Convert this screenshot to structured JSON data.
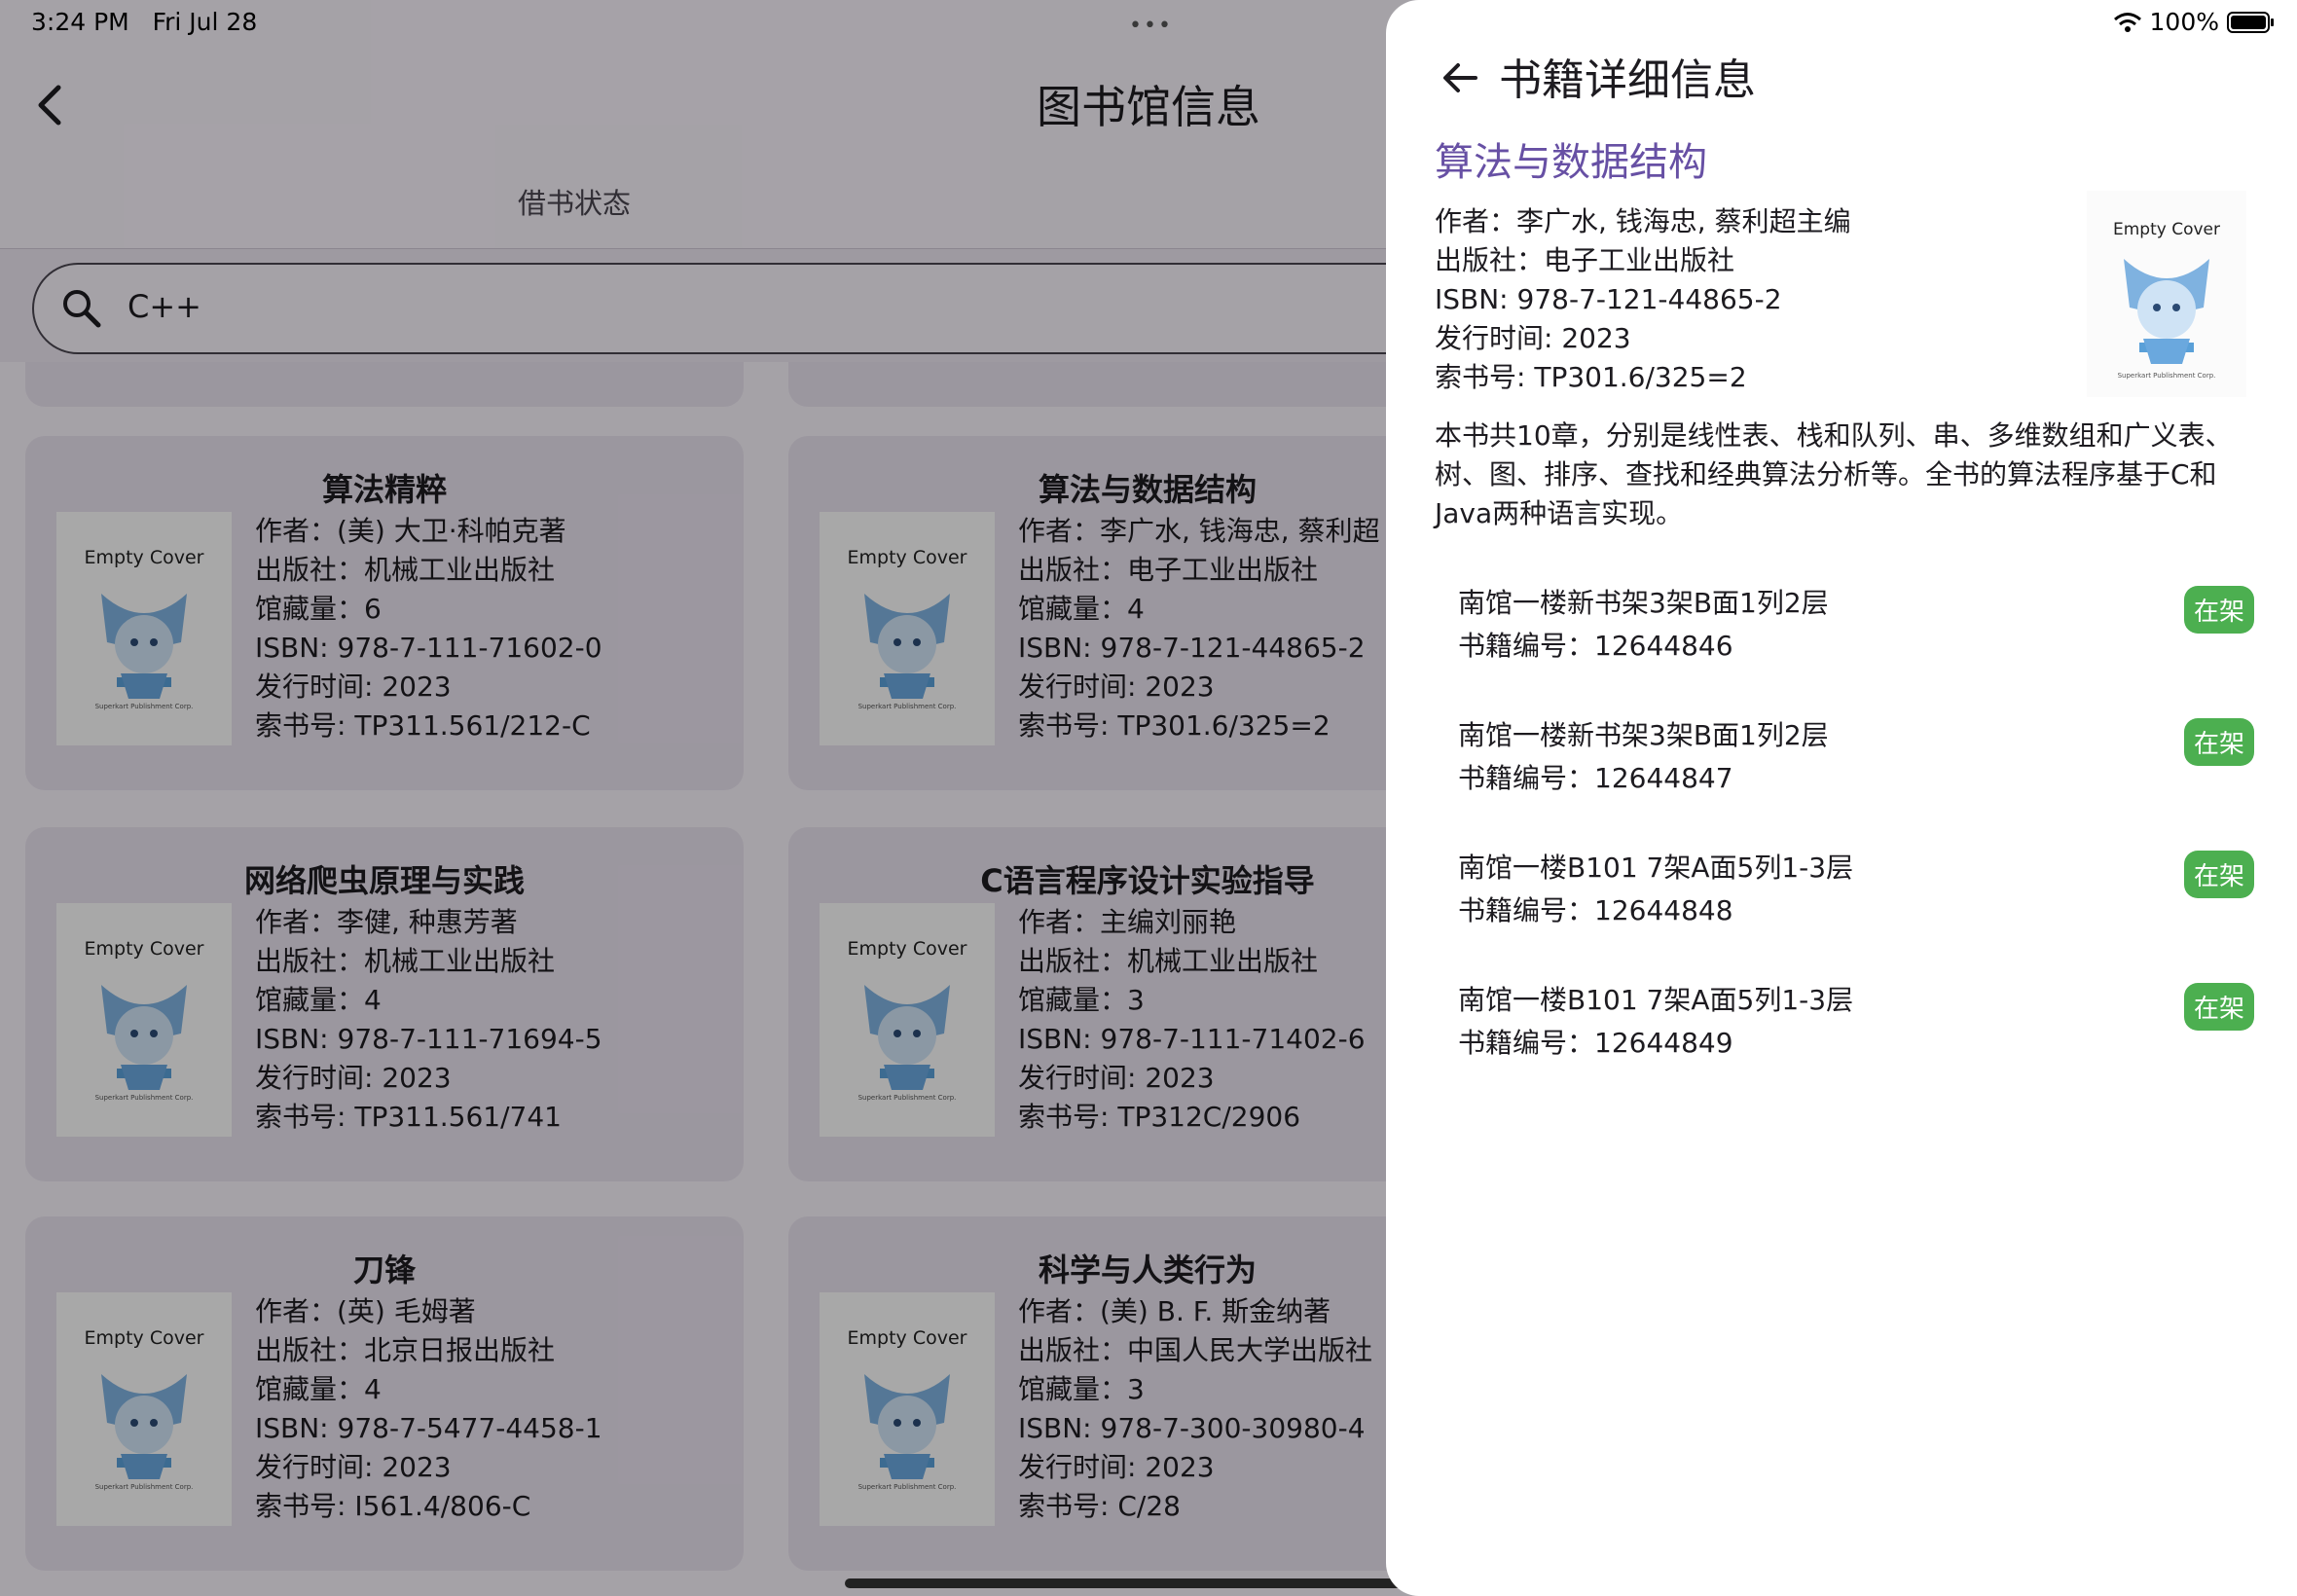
{
  "status_bar": {
    "time": "3:24 PM",
    "date": "Fri Jul 28",
    "battery": "100%"
  },
  "app": {
    "title": "图书馆信息",
    "tabs": [
      {
        "label": "借书状态"
      }
    ],
    "search": {
      "value": "C++"
    }
  },
  "book_cards": [
    {
      "title": "算法精粹",
      "cover": {
        "label": "Empty Cover",
        "publisher_mark": "Superkart Publishment Corp."
      },
      "lines": [
        "作者：(美) 大卫·科帕克著",
        "出版社：机械工业出版社",
        "馆藏量：6",
        "ISBN: 978-7-111-71602-0",
        "发行时间: 2023",
        "索书号: TP311.561/212-C"
      ]
    },
    {
      "title": "算法与数据结构",
      "cover": {
        "label": "Empty Cover",
        "publisher_mark": "Superkart Publishment Corp."
      },
      "lines": [
        "作者：李广水, 钱海忠, 蔡利超",
        "出版社：电子工业出版社",
        "馆藏量：4",
        "ISBN: 978-7-121-44865-2",
        "发行时间: 2023",
        "索书号: TP301.6/325=2"
      ]
    },
    {
      "title": "网络爬虫原理与实践",
      "cover": {
        "label": "Empty Cover",
        "publisher_mark": "Superkart Publishment Corp."
      },
      "lines": [
        "作者：李健, 种惠芳著",
        "出版社：机械工业出版社",
        "馆藏量：4",
        "ISBN: 978-7-111-71694-5",
        "发行时间: 2023",
        "索书号: TP311.561/741"
      ]
    },
    {
      "title": "C语言程序设计实验指导",
      "cover": {
        "label": "Empty Cover",
        "publisher_mark": "Superkart Publishment Corp."
      },
      "lines": [
        "作者：主编刘丽艳",
        "出版社：机械工业出版社",
        "馆藏量：3",
        "ISBN: 978-7-111-71402-6",
        "发行时间: 2023",
        "索书号: TP312C/2906"
      ]
    },
    {
      "title": "刀锋",
      "cover": {
        "label": "Empty Cover",
        "publisher_mark": "Superkart Publishment Corp."
      },
      "lines": [
        "作者：(英) 毛姆著",
        "出版社：北京日报出版社",
        "馆藏量：4",
        "ISBN: 978-7-5477-4458-1",
        "发行时间: 2023",
        "索书号: I561.4/806-C"
      ]
    },
    {
      "title": "科学与人类行为",
      "cover": {
        "label": "Empty Cover",
        "publisher_mark": "Superkart Publishment Corp."
      },
      "lines": [
        "作者：(美) B. F. 斯金纳著",
        "出版社：中国人民大学出版社",
        "馆藏量：3",
        "ISBN: 978-7-300-30980-4",
        "发行时间: 2023",
        "索书号: C/28"
      ]
    }
  ],
  "detail": {
    "header": "书籍详细信息",
    "title": "算法与数据结构",
    "meta": [
      "作者：李广水, 钱海忠, 蔡利超主编",
      "出版社：电子工业出版社",
      "ISBN: 978-7-121-44865-2",
      "发行时间: 2023",
      "索书号: TP301.6/325=2"
    ],
    "cover": {
      "label": "Empty Cover",
      "publisher_mark": "Superkart Publishment Corp."
    },
    "description": "本书共10章，分别是线性表、栈和队列、串、多维数组和广义表、树、图、排序、查找和经典算法分析等。全书的算法程序基于C和Java两种语言实现。",
    "copies": [
      {
        "location": "南馆一楼新书架3架B面1列2层",
        "id": "书籍编号：12644846",
        "status": "在架"
      },
      {
        "location": "南馆一楼新书架3架B面1列2层",
        "id": "书籍编号：12644847",
        "status": "在架"
      },
      {
        "location": "南馆一楼B101 7架A面5列1-3层",
        "id": "书籍编号：12644848",
        "status": "在架"
      },
      {
        "location": "南馆一楼B101 7架A面5列1-3层",
        "id": "书籍编号：12644849",
        "status": "在架"
      }
    ]
  },
  "colors": {
    "accent": "#6750a4",
    "badge": "#4caf50",
    "card": "#e8e1ee"
  }
}
